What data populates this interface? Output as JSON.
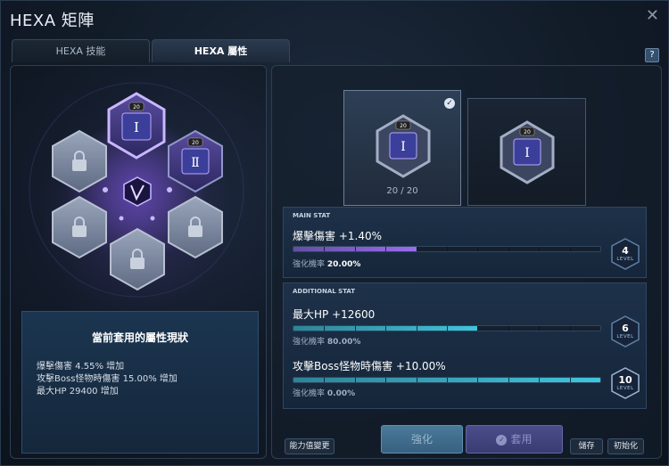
{
  "window": {
    "title": "HEXA 矩陣"
  },
  "tabs": [
    {
      "label": "HEXA 技能",
      "active": false
    },
    {
      "label": "HEXA 屬性",
      "active": true
    }
  ],
  "help_label": "?",
  "close_icon": "close-icon",
  "hex_grid": {
    "nodes": [
      {
        "id": "top",
        "state": "active",
        "level": "20",
        "glyph": "Ⅰ"
      },
      {
        "id": "upper-right",
        "state": "active",
        "level": "20",
        "glyph": "Ⅱ"
      },
      {
        "id": "upper-left",
        "state": "locked"
      },
      {
        "id": "lower-left",
        "state": "locked"
      },
      {
        "id": "lower-right",
        "state": "locked"
      },
      {
        "id": "bottom",
        "state": "locked"
      }
    ],
    "center_icon": "hexa-emblem-icon"
  },
  "status": {
    "title": "當前套用的屬性現狀",
    "lines": [
      "爆擊傷害 4.55% 增加",
      "攻擊Boss怪物時傷害 15.00% 增加",
      "最大HP 29400 增加"
    ]
  },
  "cards": [
    {
      "level": "20",
      "glyph": "Ⅰ",
      "count": "20 / 20",
      "selected": true
    },
    {
      "level": "20",
      "glyph": "Ⅰ",
      "selected": false
    }
  ],
  "main_stat": {
    "label": "MAIN STAT",
    "name": "爆擊傷害 +1.40%",
    "rate_label": "強化機率",
    "rate_value": "20.00%",
    "level": "4",
    "level_word": "LEVEL",
    "progress": 0.4,
    "color": "#9a6cf0"
  },
  "additional": {
    "label": "ADDITIONAL STAT",
    "stats": [
      {
        "name": "最大HP +12600",
        "rate_label": "強化機率",
        "rate_value": "80.00%",
        "level": "6",
        "level_word": "LEVEL",
        "progress": 0.6,
        "color": "#3fc6dc"
      },
      {
        "name": "攻擊Boss怪物時傷害 +10.00%",
        "rate_label": "強化機率",
        "rate_value": "0.00%",
        "level": "10",
        "level_word": "LEVEL",
        "progress": 1.0,
        "color": "#3fc6dc"
      }
    ]
  },
  "buttons": {
    "reset_stats": "能力值變更",
    "enhance": "強化",
    "apply": "套用",
    "save": "儲存",
    "initialize": "初始化"
  }
}
